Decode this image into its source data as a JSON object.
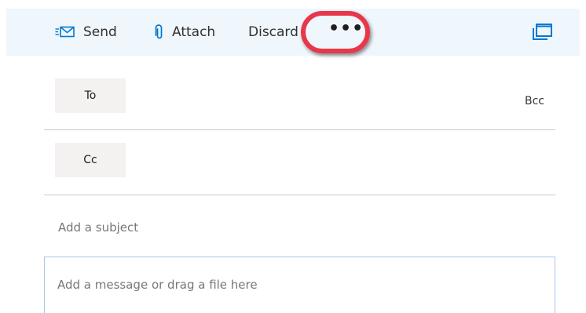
{
  "toolbar": {
    "send_label": "Send",
    "attach_label": "Attach",
    "discard_label": "Discard",
    "more_label": "•••",
    "send_icon": "send-envelope-icon",
    "attach_icon": "paperclip-icon",
    "popout_icon": "pop-out-window-icon"
  },
  "recipients": {
    "to_label": "To",
    "cc_label": "Cc",
    "bcc_label": "Bcc"
  },
  "subject": {
    "placeholder": "Add a subject"
  },
  "body": {
    "placeholder": "Add a message or drag a file here"
  },
  "colors": {
    "toolbar_bg": "#eff6fc",
    "highlight": "#e8374a",
    "accent": "#0078d4"
  }
}
